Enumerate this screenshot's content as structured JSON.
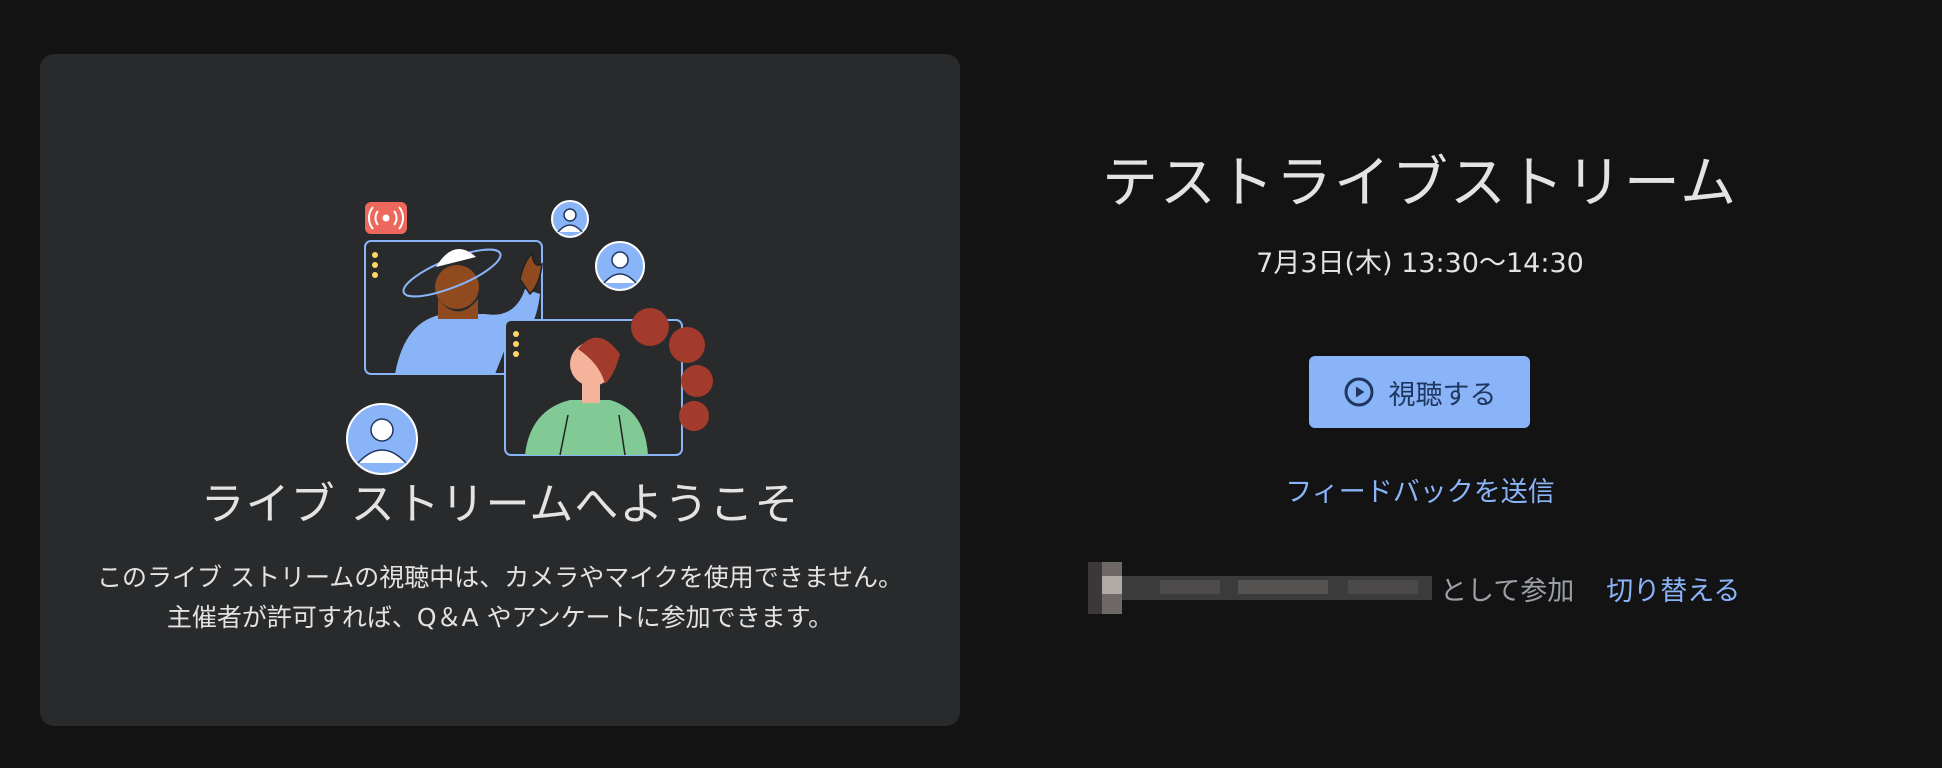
{
  "welcome": {
    "title": "ライブ ストリームへようこそ",
    "description": "このライブ ストリームの視聴中は、カメラやマイクを使用できません。主催者が許可すれば、Q＆A やアンケートに参加できます。"
  },
  "event": {
    "title": "テストライブストリーム",
    "time": "7月3日(木) 13:30〜14:30",
    "watch_button_label": "視聴する",
    "feedback_link": "フィードバックを送信",
    "join_as_text": "として参加",
    "switch_link": "切り替える"
  },
  "icons": {
    "watch": "play-circle-icon",
    "live": "broadcast-icon",
    "avatar": "account-circle-icon"
  },
  "colors": {
    "background": "#131314",
    "card": "#282a2c",
    "accent": "#8ab4f8",
    "live_badge": "#ee675c"
  }
}
